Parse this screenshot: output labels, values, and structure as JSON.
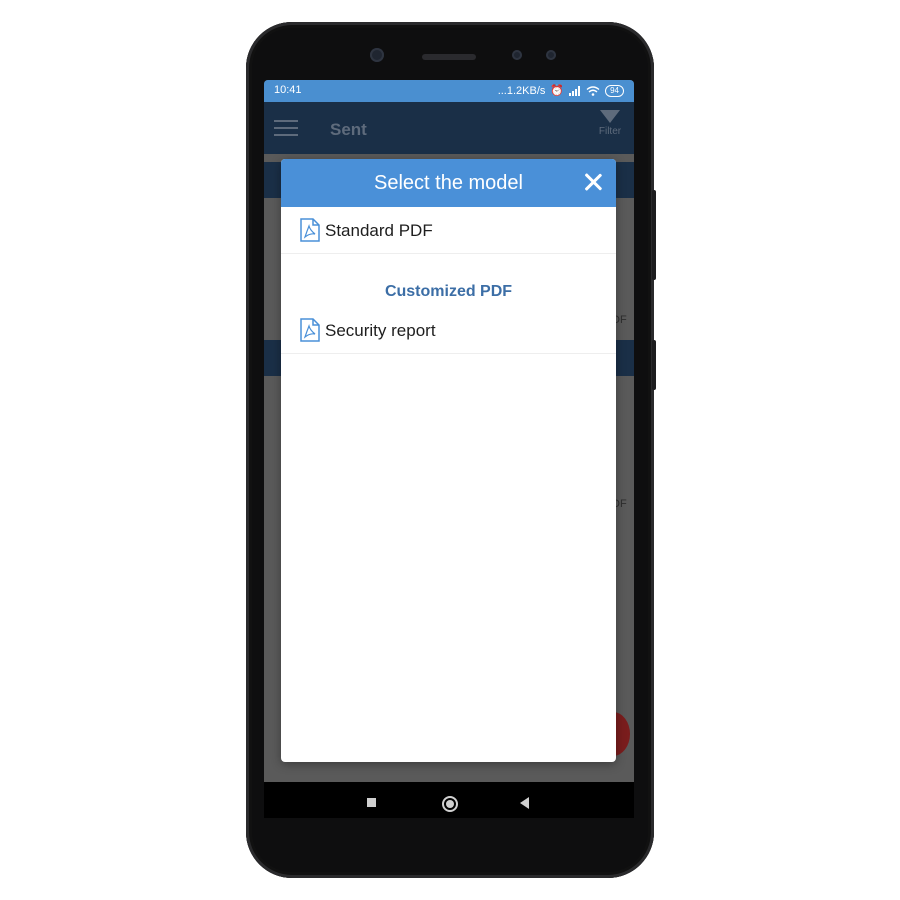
{
  "statusbar": {
    "time": "10:41",
    "network_speed": "...1.2KB/s",
    "battery": "94"
  },
  "appbar": {
    "title": "Sent",
    "filter_label": "Filter"
  },
  "background": {
    "ghost_pdf_1": "DF",
    "ghost_pdf_2": "DF"
  },
  "modal": {
    "title": "Select the model",
    "items": [
      {
        "label": "Standard PDF",
        "icon": "pdf-file-icon"
      }
    ],
    "section_title": "Customized PDF",
    "custom_items": [
      {
        "label": "Security report",
        "icon": "pdf-file-icon"
      }
    ]
  },
  "colors": {
    "accent": "#4a90d8",
    "section": "#3c6ea6",
    "appbar": "#1a2f47"
  }
}
